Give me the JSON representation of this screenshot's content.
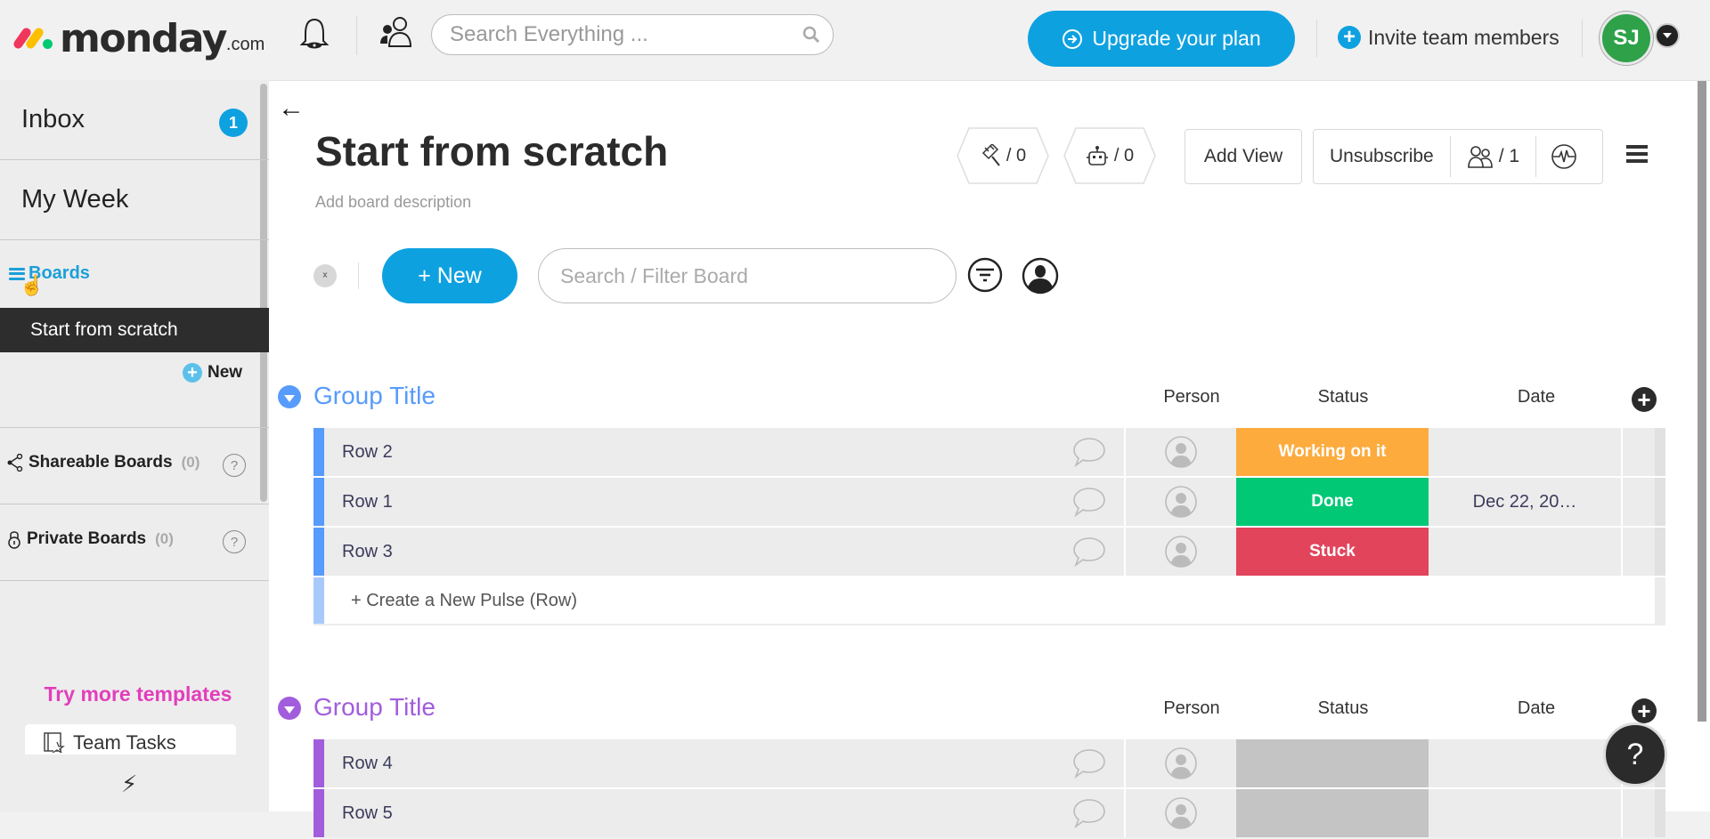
{
  "app": {
    "logo_text": "monday",
    "logo_suffix": ".com"
  },
  "topbar": {
    "search_placeholder": "Search Everything ...",
    "upgrade_label": "Upgrade your plan",
    "invite_label": "Invite team members",
    "avatar_initials": "SJ",
    "colors": {
      "accent": "#0ea1e0",
      "avatar_bg": "#2ea149"
    }
  },
  "sidebar": {
    "inbox_label": "Inbox",
    "inbox_count": "1",
    "my_week_label": "My Week",
    "boards_label": "Boards",
    "selected_board": "Start from scratch",
    "new_label": "New",
    "shareable_label": "Shareable Boards",
    "shareable_count": "(0)",
    "private_label": "Private Boards",
    "private_count": "(0)",
    "help_glyph": "?",
    "templates_heading": "Try more templates",
    "template_item": "Team Tasks",
    "templates_color": "#e23ebb"
  },
  "board": {
    "back_glyph": "←",
    "title": "Start from scratch",
    "description_placeholder": "Add board description",
    "integrations_count": "/ 0",
    "automations_count": "/ 0",
    "add_view_label": "Add View",
    "unsubscribe_label": "Unsubscribe",
    "members_count": "/ 1",
    "new_item_label": "+ New",
    "filter_placeholder": "Search / Filter Board"
  },
  "groups": [
    {
      "title": "Group Title",
      "color": "#579bfc",
      "columns": {
        "person": "Person",
        "status": "Status",
        "date": "Date"
      },
      "rows": [
        {
          "name": "Row 2",
          "status": "Working on it",
          "status_color": "#fdab3d",
          "date": ""
        },
        {
          "name": "Row 1",
          "status": "Done",
          "status_color": "#00c875",
          "date": "Dec 22, 20…"
        },
        {
          "name": "Row 3",
          "status": "Stuck",
          "status_color": "#e2445c",
          "date": ""
        }
      ],
      "create_row_label": "+ Create a New Pulse (Row)"
    },
    {
      "title": "Group Title",
      "color": "#a25ddc",
      "columns": {
        "person": "Person",
        "status": "Status",
        "date": "Date"
      },
      "rows": [
        {
          "name": "Row 4",
          "status": "",
          "status_color": "#c4c4c4",
          "date": ""
        },
        {
          "name": "Row 5",
          "status": "",
          "status_color": "#c4c4c4",
          "date": ""
        }
      ]
    }
  ],
  "help_fab": "?"
}
